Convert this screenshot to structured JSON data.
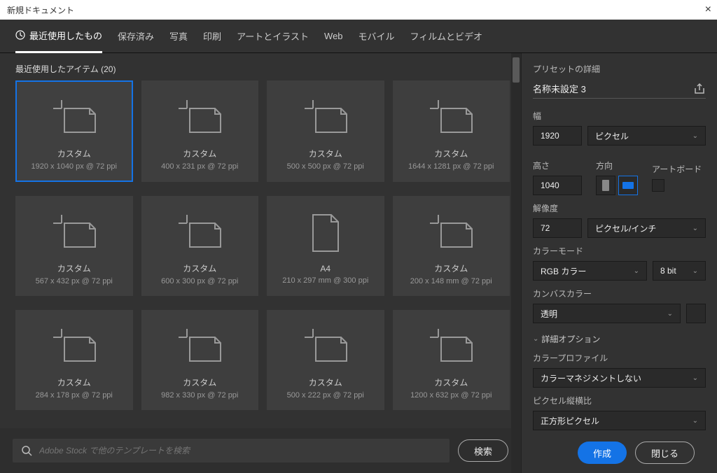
{
  "window": {
    "title": "新規ドキュメント",
    "close": "×"
  },
  "tabs": [
    {
      "id": "recent",
      "label": "最近使用したもの",
      "icon": "clock-icon",
      "active": true
    },
    {
      "id": "saved",
      "label": "保存済み"
    },
    {
      "id": "photo",
      "label": "写真"
    },
    {
      "id": "print",
      "label": "印刷"
    },
    {
      "id": "art",
      "label": "アートとイラスト"
    },
    {
      "id": "web",
      "label": "Web"
    },
    {
      "id": "mobile",
      "label": "モバイル"
    },
    {
      "id": "film",
      "label": "フィルムとビデオ"
    }
  ],
  "recent": {
    "header": "最近使用したアイテム (20)",
    "items": [
      {
        "name": "カスタム",
        "dims": "1920 x 1040 px @ 72 ppi",
        "icon": "custom",
        "selected": true
      },
      {
        "name": "カスタム",
        "dims": "400 x 231 px @ 72 ppi",
        "icon": "custom"
      },
      {
        "name": "カスタム",
        "dims": "500 x 500 px @ 72 ppi",
        "icon": "custom"
      },
      {
        "name": "カスタム",
        "dims": "1644 x 1281 px @ 72 ppi",
        "icon": "custom"
      },
      {
        "name": "カスタム",
        "dims": "567 x 432 px @ 72 ppi",
        "icon": "custom"
      },
      {
        "name": "カスタム",
        "dims": "600 x 300 px @ 72 ppi",
        "icon": "custom"
      },
      {
        "name": "A4",
        "dims": "210 x 297 mm @ 300 ppi",
        "icon": "paper"
      },
      {
        "name": "カスタム",
        "dims": "200 x 148 mm @ 72 ppi",
        "icon": "custom"
      },
      {
        "name": "カスタム",
        "dims": "284 x 178 px @ 72 ppi",
        "icon": "custom"
      },
      {
        "name": "カスタム",
        "dims": "982 x 330 px @ 72 ppi",
        "icon": "custom"
      },
      {
        "name": "カスタム",
        "dims": "500 x 222 px @ 72 ppi",
        "icon": "custom"
      },
      {
        "name": "カスタム",
        "dims": "1200 x 632 px @ 72 ppi",
        "icon": "custom"
      }
    ]
  },
  "search": {
    "placeholder": "Adobe Stock で他のテンプレートを検索",
    "button": "検索"
  },
  "preset": {
    "title": "プリセットの詳細",
    "name": "名称未設定 3",
    "labels": {
      "width": "幅",
      "height": "高さ",
      "orient": "方向",
      "artboard": "アートボード",
      "resolution": "解像度",
      "colorMode": "カラーモード",
      "background": "カンバスカラー",
      "advanced": "詳細オプション",
      "profile": "カラープロファイル",
      "pixelRatio": "ピクセル縦横比"
    },
    "width": "1920",
    "height": "1040",
    "unit": "ピクセル",
    "resolution": "72",
    "resUnit": "ピクセル/インチ",
    "colorMode": "RGB カラー",
    "bit": "8 bit",
    "background": "透明",
    "profile": "カラーマネジメントしない",
    "pixelRatio": "正方形ピクセル"
  },
  "actions": {
    "create": "作成",
    "close": "閉じる"
  }
}
